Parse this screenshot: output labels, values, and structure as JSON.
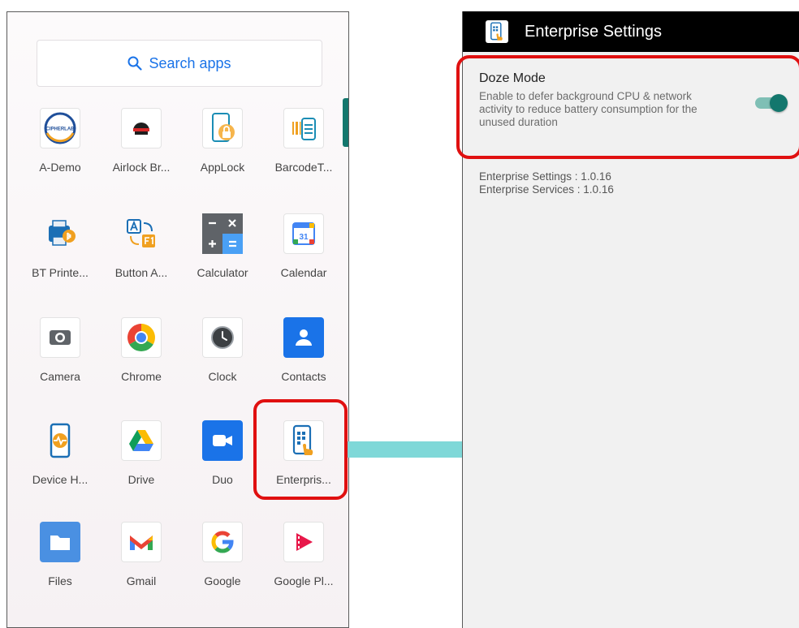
{
  "drawer": {
    "search_placeholder": "Search apps",
    "apps": [
      {
        "label": "A-Demo",
        "icon": "cipherlab-icon"
      },
      {
        "label": "Airlock Br...",
        "icon": "airlock-icon"
      },
      {
        "label": "AppLock",
        "icon": "applock-icon"
      },
      {
        "label": "BarcodeT...",
        "icon": "barcode-icon"
      },
      {
        "label": "BT Printe...",
        "icon": "bt-printer-icon"
      },
      {
        "label": "Button A...",
        "icon": "button-assign-icon"
      },
      {
        "label": "Calculator",
        "icon": "calculator-icon"
      },
      {
        "label": "Calendar",
        "icon": "calendar-icon"
      },
      {
        "label": "Camera",
        "icon": "camera-icon"
      },
      {
        "label": "Chrome",
        "icon": "chrome-icon"
      },
      {
        "label": "Clock",
        "icon": "clock-icon"
      },
      {
        "label": "Contacts",
        "icon": "contacts-icon"
      },
      {
        "label": "Device H...",
        "icon": "device-health-icon"
      },
      {
        "label": "Drive",
        "icon": "drive-icon"
      },
      {
        "label": "Duo",
        "icon": "duo-icon"
      },
      {
        "label": "Enterpris...",
        "icon": "enterprise-settings-icon"
      },
      {
        "label": "Files",
        "icon": "files-icon"
      },
      {
        "label": "Gmail",
        "icon": "gmail-icon"
      },
      {
        "label": "Google",
        "icon": "google-icon"
      },
      {
        "label": "Google Pl...",
        "icon": "google-play-movies-icon"
      }
    ],
    "cipherlab_logo_text": "CIPHERLAB",
    "calendar_day": "31"
  },
  "settings": {
    "title": "Enterprise Settings",
    "doze_title": "Doze Mode",
    "doze_description": "Enable to defer background CPU & network activity to reduce battery consumption for the unused duration",
    "doze_enabled": true,
    "version_settings": "Enterprise Settings : 1.0.16",
    "version_services": "Enterprise Services : 1.0.16"
  },
  "colors": {
    "accent": "#13776d",
    "highlight": "#e01010",
    "arrow": "#7fd8d8"
  }
}
